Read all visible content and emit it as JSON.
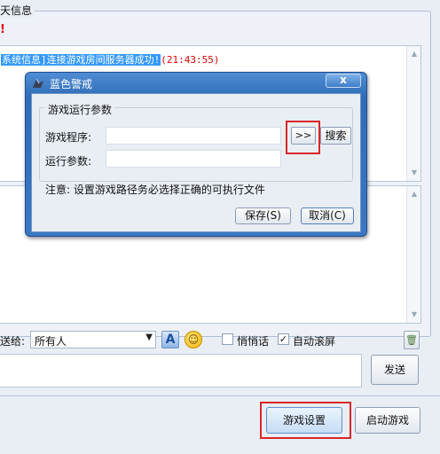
{
  "chat": {
    "title_fragment": "天信息",
    "exclaim": "!",
    "log_lines": [
      {
        "highlight": "系统信息]连接游戏房间服务器成功!",
        "time": "(21:43:55)"
      }
    ]
  },
  "sendto": {
    "label": "送给:",
    "value": "所有人"
  },
  "toolbar": {
    "font_icon": "A",
    "emoji_icon": "☺",
    "whisper_label": "悄悄话",
    "whisper_checked": false,
    "autoscroll_label": "自动滚屏",
    "autoscroll_checked": true,
    "autoscroll_mark": "✓",
    "clear_icon": "🗑"
  },
  "actions": {
    "send_label": "发送",
    "game_settings_label": "游戏设置",
    "launch_game_label": "启动游戏"
  },
  "dialog": {
    "title": "蓝色警戒",
    "close_symbol": "x",
    "group_title": "游戏运行参数",
    "exe_label": "游戏程序:",
    "exe_value": "",
    "browse_label": ">>",
    "search_label": "搜索",
    "args_label": "运行参数:",
    "args_value": "",
    "note": "注意: 设置游戏路径务必选择正确的可执行文件",
    "save_label": "保存(S)",
    "cancel_label": "取消(C)"
  },
  "colors": {
    "highlight_box": "#d9262b",
    "dialog_title_bar": "#2f6cb8",
    "log_time": "#e00000"
  }
}
